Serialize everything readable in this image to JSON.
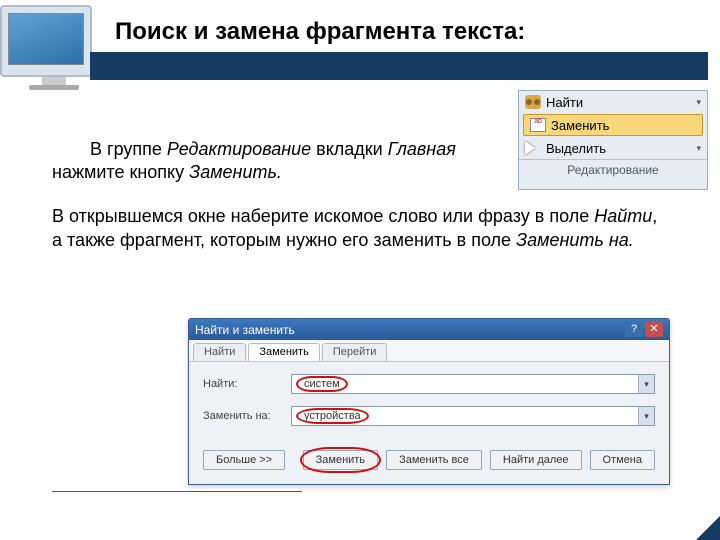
{
  "title": "Поиск и замена фрагмента текста:",
  "para1": {
    "a": "В группе ",
    "b": "Редактирование",
    "c": " вкладки ",
    "d": "Главная",
    "e": " нажмите кнопку ",
    "f": "Заменить.",
    "full_plain": "В группе Редактирование вкладки Главная нажмите кнопку Заменить."
  },
  "para2": {
    "a": "В открывшемся окне наберите искомое слово или фразу в поле ",
    "b": "Найти",
    "c": ", а также фрагмент, которым нужно его заменить в поле ",
    "d": "Заменить на."
  },
  "ribbon": {
    "find": "Найти",
    "replace": "Заменить",
    "select": "Выделить",
    "group": "Редактирование",
    "dd": "▾"
  },
  "dialog": {
    "title": "Найти и заменить",
    "help": "?",
    "close": "✕",
    "tabs": {
      "find": "Найти",
      "replace": "Заменить",
      "goto": "Перейти"
    },
    "label_find": "Найти:",
    "label_replace": "Заменить на:",
    "value_find": "систем",
    "value_replace": "устройства",
    "btn_more": "Больше >>",
    "btn_replace": "Заменить",
    "btn_replace_all": "Заменить все",
    "btn_find_next": "Найти далее",
    "btn_cancel": "Отмена",
    "dd": "▾"
  }
}
